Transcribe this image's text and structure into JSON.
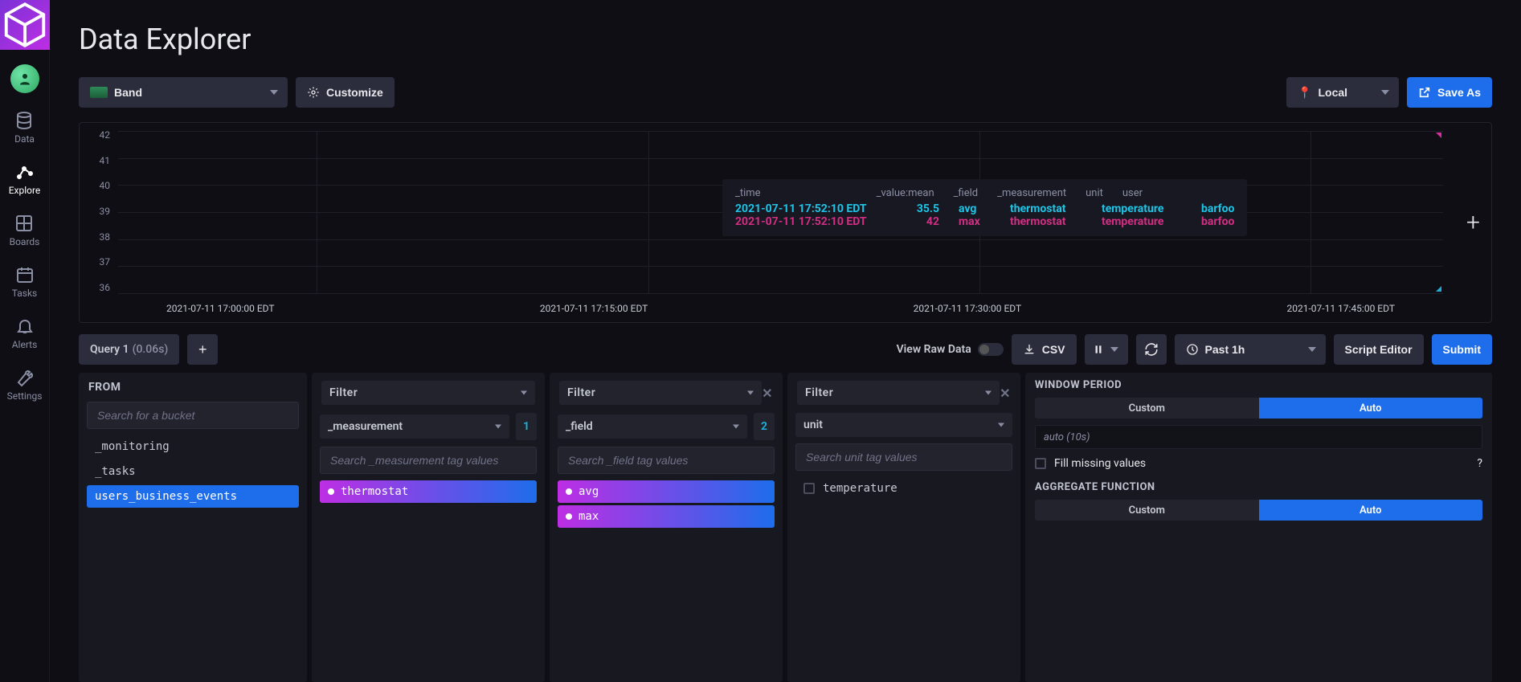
{
  "sidebar": {
    "items": [
      {
        "label": "Data"
      },
      {
        "label": "Explore"
      },
      {
        "label": "Boards"
      },
      {
        "label": "Tasks"
      },
      {
        "label": "Alerts"
      },
      {
        "label": "Settings"
      }
    ]
  },
  "page_title": "Data Explorer",
  "toolbar": {
    "viz_label": "Band",
    "customize_label": "Customize",
    "timezone_label": "Local",
    "save_as_label": "Save As"
  },
  "chart_data": {
    "type": "line",
    "y_ticks": [
      "42",
      "41",
      "40",
      "39",
      "38",
      "37",
      "36"
    ],
    "ylim": [
      36,
      42
    ],
    "x_ticks": [
      "2021-07-11 17:00:00 EDT",
      "2021-07-11 17:15:00 EDT",
      "2021-07-11 17:30:00 EDT",
      "2021-07-11 17:45:00 EDT"
    ],
    "tooltip": {
      "headers": [
        "_time",
        "_value:mean",
        "_field",
        "_measurement",
        "unit",
        "user"
      ],
      "rows": [
        {
          "color": "cyan",
          "time": "2021-07-11 17:52:10 EDT",
          "value": "35.5",
          "field": "avg",
          "measurement": "thermostat",
          "unit": "temperature",
          "user": "barfoo"
        },
        {
          "color": "pink",
          "time": "2021-07-11 17:52:10 EDT",
          "value": "42",
          "field": "max",
          "measurement": "thermostat",
          "unit": "temperature",
          "user": "barfoo"
        }
      ]
    }
  },
  "query_bar": {
    "tab_label": "Query 1",
    "tab_timing": "(0.06s)",
    "view_raw_label": "View Raw Data",
    "csv_label": "CSV",
    "past_label": "Past 1h",
    "script_editor_label": "Script Editor",
    "submit_label": "Submit"
  },
  "builder": {
    "from": {
      "title": "FROM",
      "search_placeholder": "Search for a bucket",
      "items": [
        "_monitoring",
        "_tasks",
        "users_business_events"
      ],
      "selected_index": 2
    },
    "filters": [
      {
        "label": "Filter",
        "key": "_measurement",
        "count": "1",
        "search_placeholder": "Search _measurement tag values",
        "items": [
          {
            "label": "thermostat",
            "selected": true
          }
        ],
        "closable": false
      },
      {
        "label": "Filter",
        "key": "_field",
        "count": "2",
        "search_placeholder": "Search _field tag values",
        "items": [
          {
            "label": "avg",
            "selected": true
          },
          {
            "label": "max",
            "selected": true
          }
        ],
        "closable": true
      },
      {
        "label": "Filter",
        "key": "unit",
        "count": "",
        "search_placeholder": "Search unit tag values",
        "items": [
          {
            "label": "temperature",
            "selected": false
          }
        ],
        "closable": true
      }
    ],
    "agg": {
      "window_title": "WINDOW PERIOD",
      "window_custom": "Custom",
      "window_auto": "Auto",
      "auto_value": "auto (10s)",
      "fill_label": "Fill missing values",
      "agg_title": "AGGREGATE FUNCTION",
      "agg_custom": "Custom",
      "agg_auto": "Auto"
    }
  }
}
